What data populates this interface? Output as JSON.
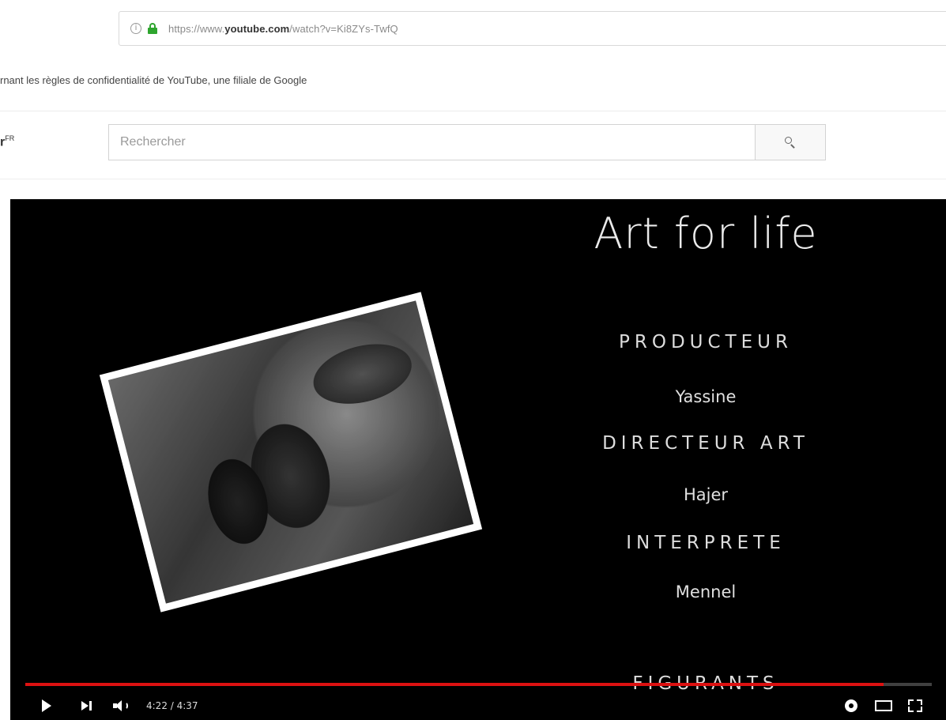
{
  "browser": {
    "url_prefix": "https://www.",
    "url_domain": "youtube.com",
    "url_path": "/watch?v=Ki8ZYs-TwfQ"
  },
  "consent": {
    "text": "rnant les règles de confidentialité de YouTube, une filiale de Google"
  },
  "masthead": {
    "logo_fragment": "r",
    "logo_sup": "FR",
    "search_placeholder": "Rechercher"
  },
  "video": {
    "title": "Art for life",
    "credits": [
      {
        "role": "PRODUCTEUR",
        "name": "Yassine"
      },
      {
        "role": "DIRECTEUR ART",
        "name": "Hajer"
      },
      {
        "role": "INTERPRETE",
        "name": "Mennel"
      }
    ],
    "extra_role": "FIGURANTS",
    "time": "4:22 / 4:37",
    "progress_fraction": 0.947
  },
  "colors": {
    "progress": "#dd1111",
    "lock": "#2ea52e"
  }
}
